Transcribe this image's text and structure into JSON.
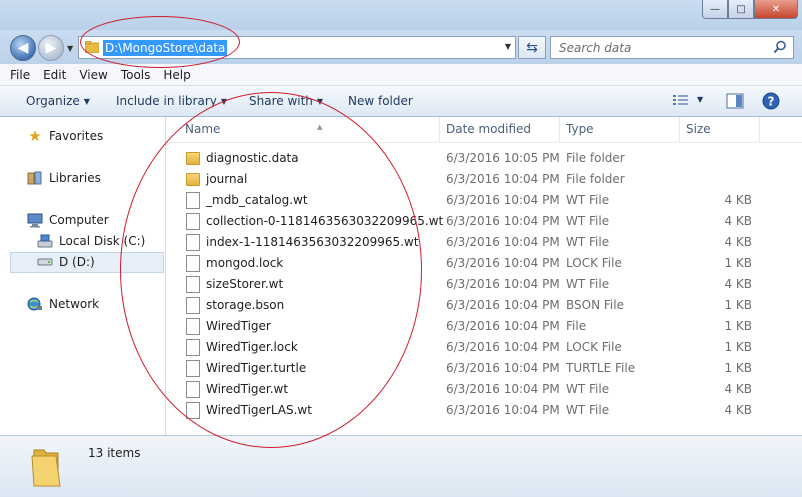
{
  "window": {
    "minimize_glyph": "—",
    "maximize_glyph": "□",
    "close_glyph": "✕"
  },
  "address": {
    "path": "D:\\MongoStore\\data",
    "search_placeholder": "Search data"
  },
  "menu": [
    "File",
    "Edit",
    "View",
    "Tools",
    "Help"
  ],
  "toolbar": {
    "organize": "Organize",
    "include_in_library": "Include in library",
    "share_with": "Share with",
    "new_folder": "New folder"
  },
  "sidebar": {
    "favorites": "Favorites",
    "libraries": "Libraries",
    "computer": "Computer",
    "local_disk": "Local Disk (C:)",
    "d_drive": "D (D:)",
    "network": "Network"
  },
  "columns": {
    "name": "Name",
    "date_modified": "Date modified",
    "type": "Type",
    "size": "Size"
  },
  "files": [
    {
      "name": "diagnostic.data",
      "date": "6/3/2016 10:05 PM",
      "type": "File folder",
      "size": "",
      "kind": "folder"
    },
    {
      "name": "journal",
      "date": "6/3/2016 10:04 PM",
      "type": "File folder",
      "size": "",
      "kind": "folder"
    },
    {
      "name": "_mdb_catalog.wt",
      "date": "6/3/2016 10:04 PM",
      "type": "WT File",
      "size": "4 KB",
      "kind": "file"
    },
    {
      "name": "collection-0-1181463563032209965.wt",
      "date": "6/3/2016 10:04 PM",
      "type": "WT File",
      "size": "4 KB",
      "kind": "file"
    },
    {
      "name": "index-1-1181463563032209965.wt",
      "date": "6/3/2016 10:04 PM",
      "type": "WT File",
      "size": "4 KB",
      "kind": "file"
    },
    {
      "name": "mongod.lock",
      "date": "6/3/2016 10:04 PM",
      "type": "LOCK File",
      "size": "1 KB",
      "kind": "file"
    },
    {
      "name": "sizeStorer.wt",
      "date": "6/3/2016 10:04 PM",
      "type": "WT File",
      "size": "4 KB",
      "kind": "file"
    },
    {
      "name": "storage.bson",
      "date": "6/3/2016 10:04 PM",
      "type": "BSON File",
      "size": "1 KB",
      "kind": "file"
    },
    {
      "name": "WiredTiger",
      "date": "6/3/2016 10:04 PM",
      "type": "File",
      "size": "1 KB",
      "kind": "file"
    },
    {
      "name": "WiredTiger.lock",
      "date": "6/3/2016 10:04 PM",
      "type": "LOCK File",
      "size": "1 KB",
      "kind": "file"
    },
    {
      "name": "WiredTiger.turtle",
      "date": "6/3/2016 10:04 PM",
      "type": "TURTLE File",
      "size": "1 KB",
      "kind": "file"
    },
    {
      "name": "WiredTiger.wt",
      "date": "6/3/2016 10:04 PM",
      "type": "WT File",
      "size": "4 KB",
      "kind": "file"
    },
    {
      "name": "WiredTigerLAS.wt",
      "date": "6/3/2016 10:04 PM",
      "type": "WT File",
      "size": "4 KB",
      "kind": "file"
    }
  ],
  "status": {
    "item_count": "13 items"
  },
  "colors": {
    "selection_blue": "#3399ff",
    "annotation_red": "#d11b2d"
  }
}
